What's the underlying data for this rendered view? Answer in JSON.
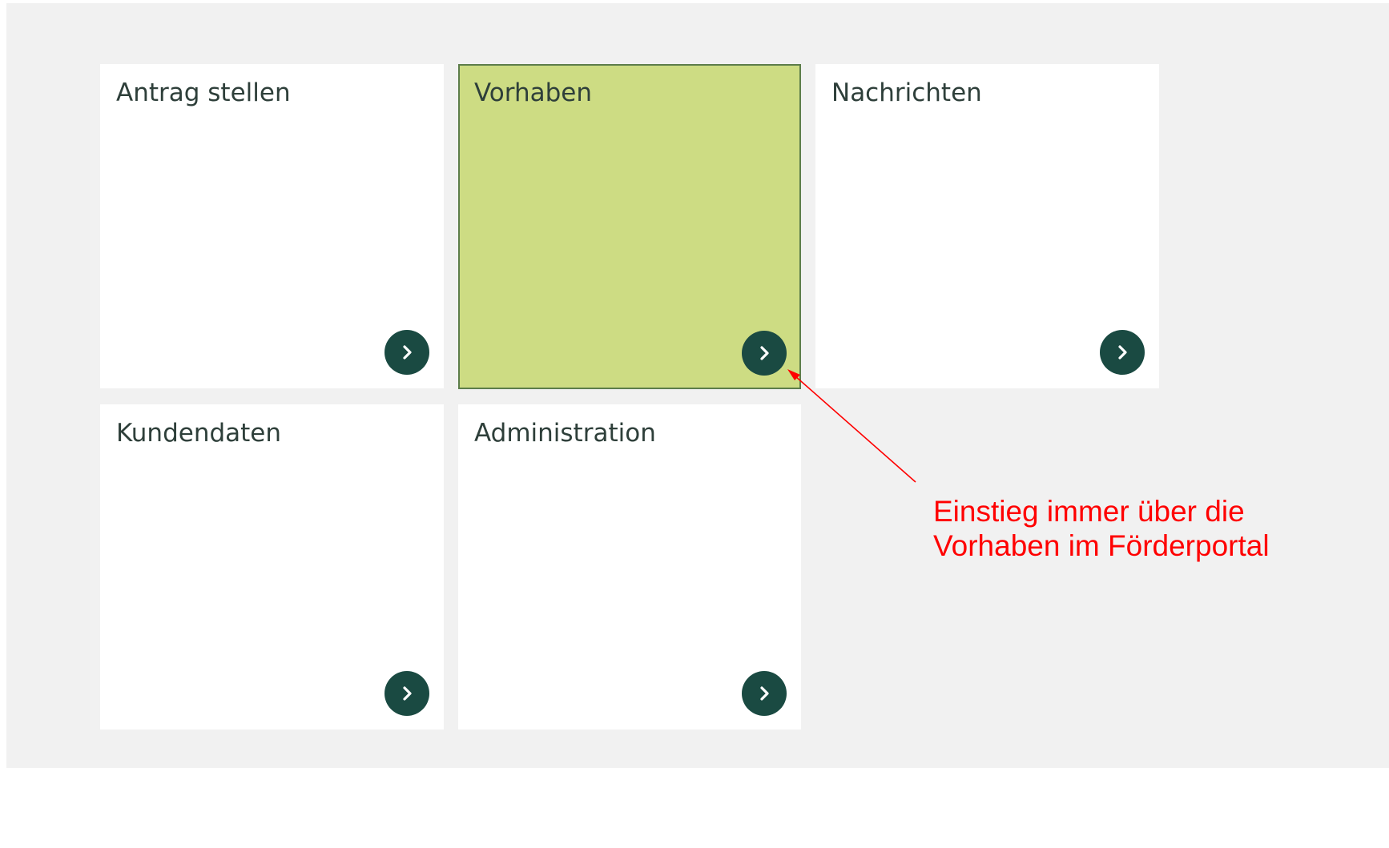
{
  "tiles": [
    {
      "title": "Antrag stellen",
      "button_icon": "chevron-right-icon"
    },
    {
      "title": "Vorhaben",
      "button_icon": "chevron-right-icon",
      "highlighted": true
    },
    {
      "title": "Nachrichten",
      "button_icon": "chevron-right-icon"
    },
    {
      "title": "Kundendaten",
      "button_icon": "chevron-right-icon"
    },
    {
      "title": "Administration",
      "button_icon": "chevron-right-icon"
    }
  ],
  "annotation": {
    "line1": "Einstieg immer über die",
    "line2": "Vorhaben im Förderportal"
  },
  "colors": {
    "page_background": "#f1f1f1",
    "tile_background": "#ffffff",
    "highlight_fill": "#cddc83",
    "highlight_border": "#5c7d4a",
    "button_fill": "#1a4a42",
    "title_text": "#2e3f3a",
    "annotation": "#ff0000"
  }
}
